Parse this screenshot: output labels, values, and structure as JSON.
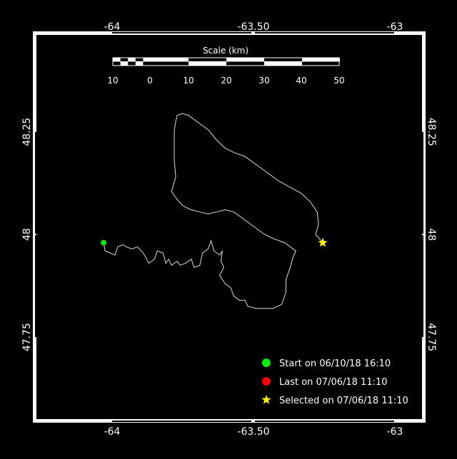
{
  "map": {
    "background": "#000000",
    "frame_color": "#ffffff",
    "track_color": "#dddddd",
    "lon_ticks": [
      {
        "value": -64,
        "label": "-64"
      },
      {
        "value": -63.5,
        "label": "-63.50"
      },
      {
        "value": -63,
        "label": "-63"
      }
    ],
    "lat_ticks": [
      {
        "value": 48.25,
        "label": "48.25"
      },
      {
        "value": 48,
        "label": "48"
      },
      {
        "value": 47.75,
        "label": "47.75"
      }
    ],
    "scale_bar": {
      "title": "Scale (km)",
      "labels": [
        "10",
        "0",
        "10",
        "20",
        "30",
        "40",
        "50"
      ]
    },
    "legend": [
      {
        "label": "Start on 06/10/18 16:10",
        "color": "#00ee00",
        "icon": "circle"
      },
      {
        "label": "Last on 07/06/18 11:10",
        "color": "#ff0000",
        "icon": "circle"
      },
      {
        "label": "Selected on 07/06/18 11:10",
        "color": "#ffee00",
        "icon": "star"
      }
    ],
    "track": [
      [
        -64.03,
        47.98
      ],
      [
        -64.025,
        47.96
      ],
      [
        -63.99,
        47.95
      ],
      [
        -63.98,
        47.97
      ],
      [
        -63.96,
        47.975
      ],
      [
        -63.95,
        47.97
      ],
      [
        -63.93,
        47.965
      ],
      [
        -63.91,
        47.97
      ],
      [
        -63.89,
        47.955
      ],
      [
        -63.87,
        47.93
      ],
      [
        -63.85,
        47.94
      ],
      [
        -63.84,
        47.96
      ],
      [
        -63.82,
        47.955
      ],
      [
        -63.81,
        47.93
      ],
      [
        -63.8,
        47.94
      ],
      [
        -63.79,
        47.925
      ],
      [
        -63.77,
        47.935
      ],
      [
        -63.76,
        47.925
      ],
      [
        -63.74,
        47.93
      ],
      [
        -63.72,
        47.94
      ],
      [
        -63.71,
        47.92
      ],
      [
        -63.69,
        47.925
      ],
      [
        -63.68,
        47.955
      ],
      [
        -63.66,
        47.965
      ],
      [
        -63.65,
        47.985
      ],
      [
        -63.64,
        47.96
      ],
      [
        -63.62,
        47.95
      ],
      [
        -63.61,
        47.96
      ],
      [
        -63.615,
        47.935
      ],
      [
        -63.605,
        47.92
      ],
      [
        -63.62,
        47.9
      ],
      [
        -63.6,
        47.88
      ],
      [
        -63.58,
        47.87
      ],
      [
        -63.57,
        47.85
      ],
      [
        -63.55,
        47.84
      ],
      [
        -63.53,
        47.84
      ],
      [
        -63.52,
        47.825
      ],
      [
        -63.49,
        47.82
      ],
      [
        -63.46,
        47.82
      ],
      [
        -63.43,
        47.82
      ],
      [
        -63.4,
        47.83
      ],
      [
        -63.385,
        47.86
      ],
      [
        -63.385,
        47.89
      ],
      [
        -63.37,
        47.92
      ],
      [
        -63.36,
        47.945
      ],
      [
        -63.35,
        47.96
      ],
      [
        -63.36,
        47.965
      ],
      [
        -63.39,
        47.98
      ],
      [
        -63.43,
        47.99
      ],
      [
        -63.46,
        48.0
      ],
      [
        -63.5,
        48.02
      ],
      [
        -63.54,
        48.04
      ],
      [
        -63.57,
        48.055
      ],
      [
        -63.6,
        48.06
      ],
      [
        -63.63,
        48.055
      ],
      [
        -63.66,
        48.05
      ],
      [
        -63.69,
        48.055
      ],
      [
        -63.72,
        48.06
      ],
      [
        -63.75,
        48.07
      ],
      [
        -63.77,
        48.085
      ],
      [
        -63.79,
        48.105
      ],
      [
        -63.775,
        48.14
      ],
      [
        -63.78,
        48.18
      ],
      [
        -63.78,
        48.215
      ],
      [
        -63.78,
        48.255
      ],
      [
        -63.775,
        48.275
      ],
      [
        -63.77,
        48.29
      ],
      [
        -63.75,
        48.295
      ],
      [
        -63.73,
        48.29
      ],
      [
        -63.7,
        48.275
      ],
      [
        -63.66,
        48.255
      ],
      [
        -63.63,
        48.23
      ],
      [
        -63.6,
        48.21
      ],
      [
        -63.57,
        48.2
      ],
      [
        -63.53,
        48.19
      ],
      [
        -63.49,
        48.17
      ],
      [
        -63.45,
        48.15
      ],
      [
        -63.41,
        48.13
      ],
      [
        -63.37,
        48.115
      ],
      [
        -63.33,
        48.1
      ],
      [
        -63.3,
        48.08
      ],
      [
        -63.275,
        48.055
      ],
      [
        -63.27,
        48.025
      ],
      [
        -63.28,
        48.0
      ],
      [
        -63.255,
        47.98
      ]
    ],
    "markers": {
      "start": {
        "lon": -64.03,
        "lat": 47.98
      },
      "last": {
        "lon": -63.255,
        "lat": 47.98
      },
      "selected": {
        "lon": -63.255,
        "lat": 47.98
      }
    }
  }
}
